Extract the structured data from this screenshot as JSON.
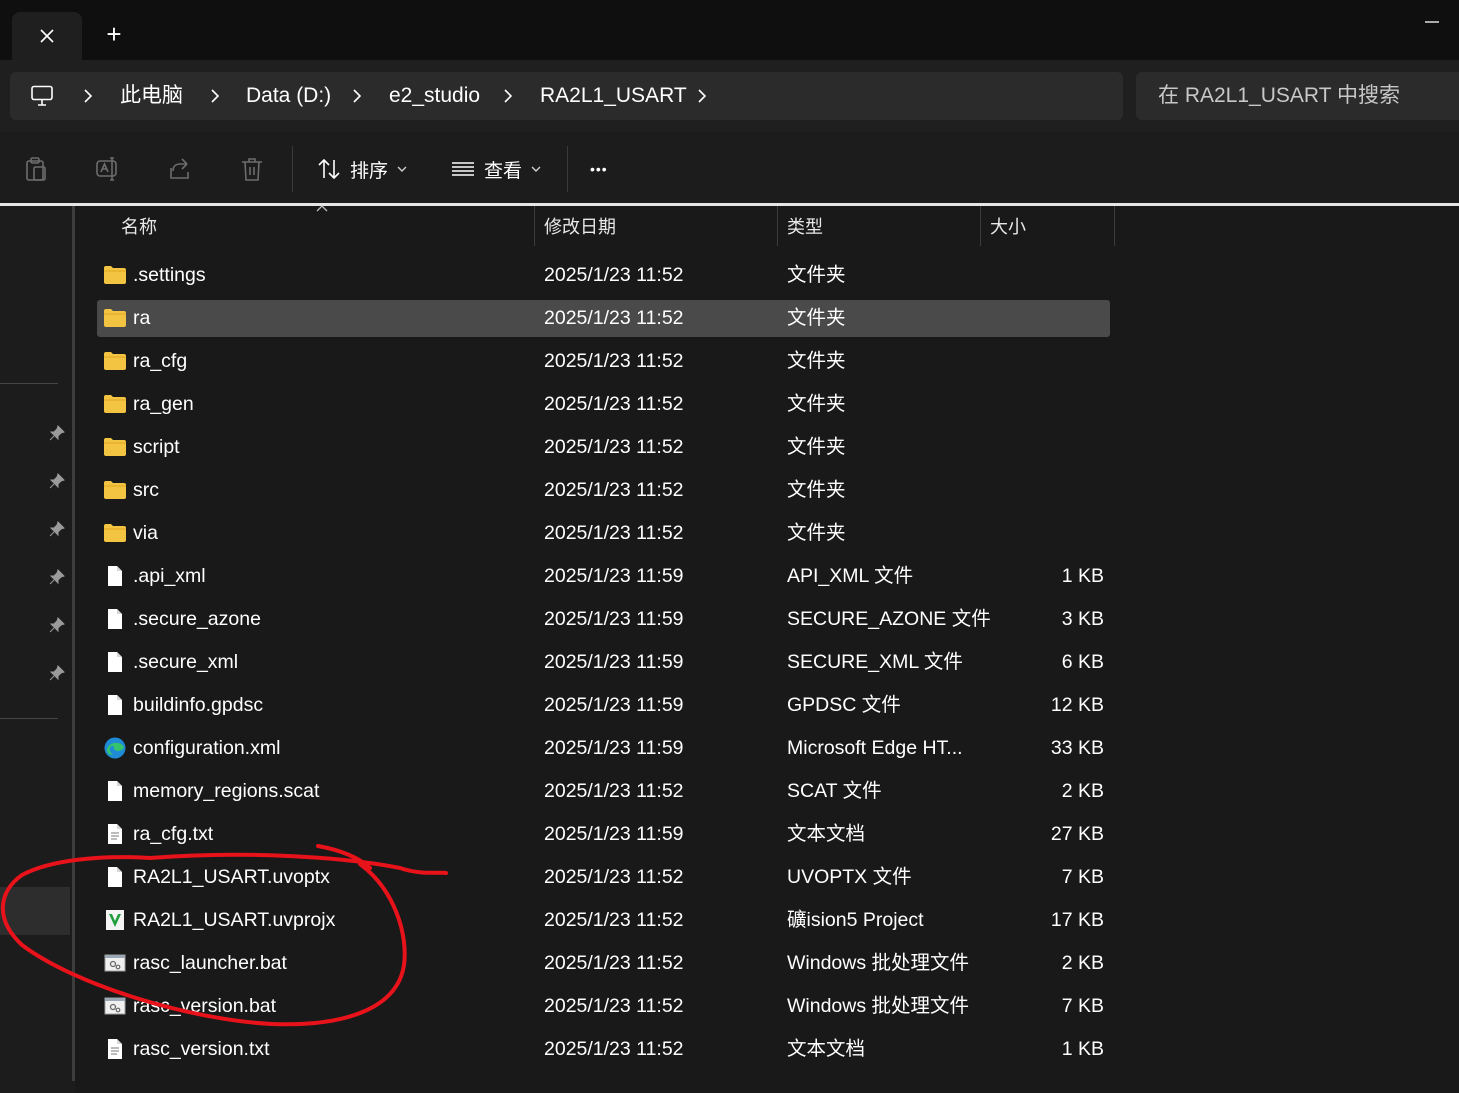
{
  "window": {
    "new_tab_label": "+"
  },
  "address": {
    "crumbs": [
      "此电脑",
      "Data (D:)",
      "e2_studio",
      "RA2L1_USART"
    ]
  },
  "search": {
    "placeholder": "在 RA2L1_USART 中搜索"
  },
  "toolbar": {
    "sort_label": "排序",
    "view_label": "查看",
    "more_label": "•••"
  },
  "columns": {
    "name": "名称",
    "date": "修改日期",
    "type": "类型",
    "size": "大小"
  },
  "files": [
    {
      "name": ".settings",
      "date": "2025/1/23 11:52",
      "type": "文件夹",
      "size": "",
      "icon": "folder-icon"
    },
    {
      "name": "ra",
      "date": "2025/1/23 11:52",
      "type": "文件夹",
      "size": "",
      "icon": "folder-icon",
      "selected": true
    },
    {
      "name": "ra_cfg",
      "date": "2025/1/23 11:52",
      "type": "文件夹",
      "size": "",
      "icon": "folder-icon"
    },
    {
      "name": "ra_gen",
      "date": "2025/1/23 11:52",
      "type": "文件夹",
      "size": "",
      "icon": "folder-icon"
    },
    {
      "name": "script",
      "date": "2025/1/23 11:52",
      "type": "文件夹",
      "size": "",
      "icon": "folder-icon"
    },
    {
      "name": "src",
      "date": "2025/1/23 11:52",
      "type": "文件夹",
      "size": "",
      "icon": "folder-icon"
    },
    {
      "name": "via",
      "date": "2025/1/23 11:52",
      "type": "文件夹",
      "size": "",
      "icon": "folder-icon"
    },
    {
      "name": ".api_xml",
      "date": "2025/1/23 11:59",
      "type": "API_XML 文件",
      "size": "1 KB",
      "icon": "file-icon"
    },
    {
      "name": ".secure_azone",
      "date": "2025/1/23 11:59",
      "type": "SECURE_AZONE 文件",
      "size": "3 KB",
      "icon": "file-icon"
    },
    {
      "name": ".secure_xml",
      "date": "2025/1/23 11:59",
      "type": "SECURE_XML 文件",
      "size": "6 KB",
      "icon": "file-icon"
    },
    {
      "name": "buildinfo.gpdsc",
      "date": "2025/1/23 11:59",
      "type": "GPDSC 文件",
      "size": "12 KB",
      "icon": "file-icon"
    },
    {
      "name": "configuration.xml",
      "date": "2025/1/23 11:59",
      "type": "Microsoft Edge HT...",
      "size": "33 KB",
      "icon": "edge-icon"
    },
    {
      "name": "memory_regions.scat",
      "date": "2025/1/23 11:52",
      "type": "SCAT 文件",
      "size": "2 KB",
      "icon": "file-icon"
    },
    {
      "name": "ra_cfg.txt",
      "date": "2025/1/23 11:59",
      "type": "文本文档",
      "size": "27 KB",
      "icon": "text-file-icon"
    },
    {
      "name": "RA2L1_USART.uvoptx",
      "date": "2025/1/23 11:52",
      "type": "UVOPTX 文件",
      "size": "7 KB",
      "icon": "file-icon"
    },
    {
      "name": "RA2L1_USART.uvprojx",
      "date": "2025/1/23 11:52",
      "type": "礦ision5 Project",
      "size": "17 KB",
      "icon": "keil-project-icon"
    },
    {
      "name": "rasc_launcher.bat",
      "date": "2025/1/23 11:52",
      "type": "Windows 批处理文件",
      "size": "2 KB",
      "icon": "batch-file-icon"
    },
    {
      "name": "rasc_version.bat",
      "date": "2025/1/23 11:52",
      "type": "Windows 批处理文件",
      "size": "7 KB",
      "icon": "batch-file-icon"
    },
    {
      "name": "rasc_version.txt",
      "date": "2025/1/23 11:52",
      "type": "文本文档",
      "size": "1 KB",
      "icon": "text-file-icon"
    }
  ],
  "colors": {
    "background": "#191919",
    "selected_row": "#4a4a4a",
    "folder": "#f3c342",
    "annotation": "#e8121a"
  }
}
